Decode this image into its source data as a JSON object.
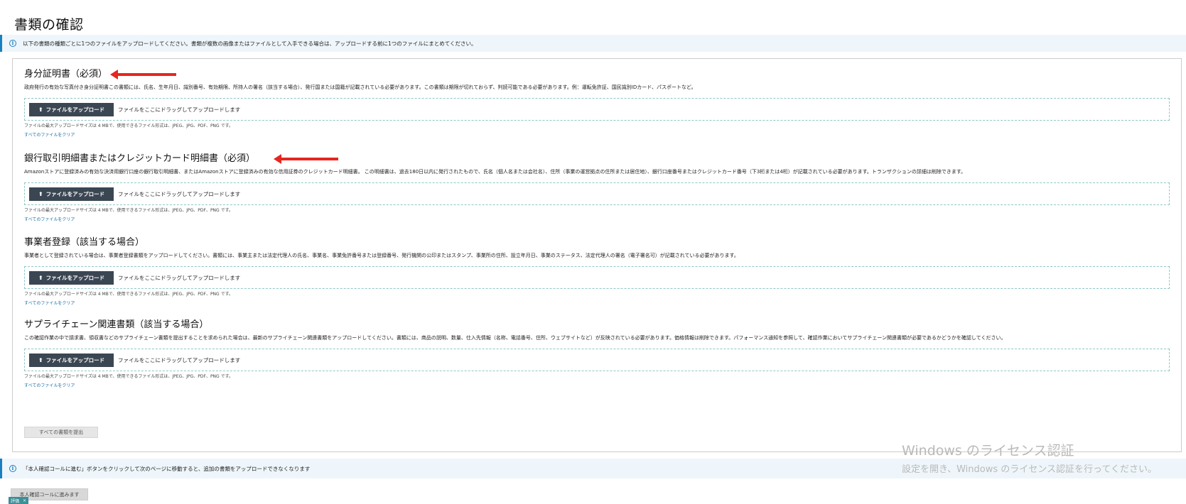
{
  "page_title": "書類の確認",
  "top_banner": {
    "icon": "info-icon",
    "text": "以下の書類の種類ごとに1つのファイルをアップロードしてください。書類が複数の画像またはファイルとして入手できる場合は、アップロードする前に1つのファイルにまとめてください。"
  },
  "sections": [
    {
      "title": "身分証明書（必須）",
      "description": "政府発行の有効な写真付き身分証明書この書類には、氏名、生年月日、識別番号、有効期限、所持人の署名（該当する場合）、発行国または国籍が記載されている必要があります。この書類は期限が切れておらず、判読可能である必要があります。例：運転免許証、国民識別IDカード、パスポートなど。",
      "upload_label": "ファイルをアップロード",
      "drop_text": "ファイルをここにドラッグしてアップロードします",
      "file_note": "ファイルの最大アップロードサイズは 4 MBで、使用できるファイル形式は、JPEG、JPG、PDF、PNG です。",
      "clear_label": "すべてのファイルをクリア"
    },
    {
      "title": "銀行取引明細書またはクレジットカード明細書（必須）",
      "description": "Amazonストアに登録済みの有効な決済用銀行口座の銀行取引明細書、またはAmazonストアに登録済みの有効な信用証券のクレジットカード明細書。 この明細書は、過去180日以内に発行されたもので、氏名（個人名または会社名）、住所（事業の運営拠点の住所または居住地）、銀行口座番号またはクレジットカード番号（下3桁または4桁）が記載されている必要があります。トランザクションの詳細は削除できます。",
      "upload_label": "ファイルをアップロード",
      "drop_text": "ファイルをここにドラッグしてアップロードします",
      "file_note": "ファイルの最大アップロードサイズは 4 MBで、使用できるファイル形式は、JPEG、JPG、PDF、PNG です。",
      "clear_label": "すべてのファイルをクリア"
    },
    {
      "title": "事業者登録（該当する場合）",
      "description": "事業者として登録されている場合は、事業者登録書類をアップロードしてください。書類には、事業主または法定代理人の氏名、事業名、事業免許番号または登録番号、発行機関の公印またはスタンプ、事業所の住所、設立年月日、事業のステータス、法定代理人の署名（電子署名可）が記載されている必要があります。",
      "upload_label": "ファイルをアップロード",
      "drop_text": "ファイルをここにドラッグしてアップロードします",
      "file_note": "ファイルの最大アップロードサイズは 4 MBで、使用できるファイル形式は、JPEG、JPG、PDF、PNG です。",
      "clear_label": "すべてのファイルをクリア"
    },
    {
      "title": "サプライチェーン関連書類（該当する場合）",
      "description": "この確認作業の中で請求書、領収書などのサプライチェーン書類を提出することを求められた場合は、最新のサプライチェーン関連書類をアップロードしてください。書類には、商品の説明、数量、仕入先情報（名称、電話番号、住所、ウェブサイトなど）が反映されている必要があります。価格情報は削除できます。パフォーマンス通知を参照して、確認作業においてサプライチェーン関連書類が必要であるかどうかを確認してください。",
      "upload_label": "ファイルをアップロード",
      "drop_text": "ファイルをここにドラッグしてアップロードします",
      "file_note": "ファイルの最大アップロードサイズは 4 MBで、使用できるファイル形式は、JPEG、JPG、PDF、PNG です。",
      "clear_label": "すべてのファイルをクリア"
    }
  ],
  "submit_all_label": "すべての書類を提出",
  "bottom_banner": {
    "icon": "info-icon",
    "text": "「本人確認コールに進む」ボタンをクリックして次のページに移動すると、追加の書類をアップロードできなくなります"
  },
  "proceed_label": "本人確認コールに進みます",
  "eval_badge": {
    "label": "評価",
    "close": "×"
  },
  "watermark": {
    "title": "Windows のライセンス認証",
    "subtitle": "設定を開き、Windows のライセンス認証を行ってください。"
  },
  "colors": {
    "banner_bg": "#eef6fb",
    "accent": "#1a7fc1",
    "button_dark": "#3b4653",
    "arrow": "#e8251f",
    "dropzone_border": "#8fc7c7"
  }
}
